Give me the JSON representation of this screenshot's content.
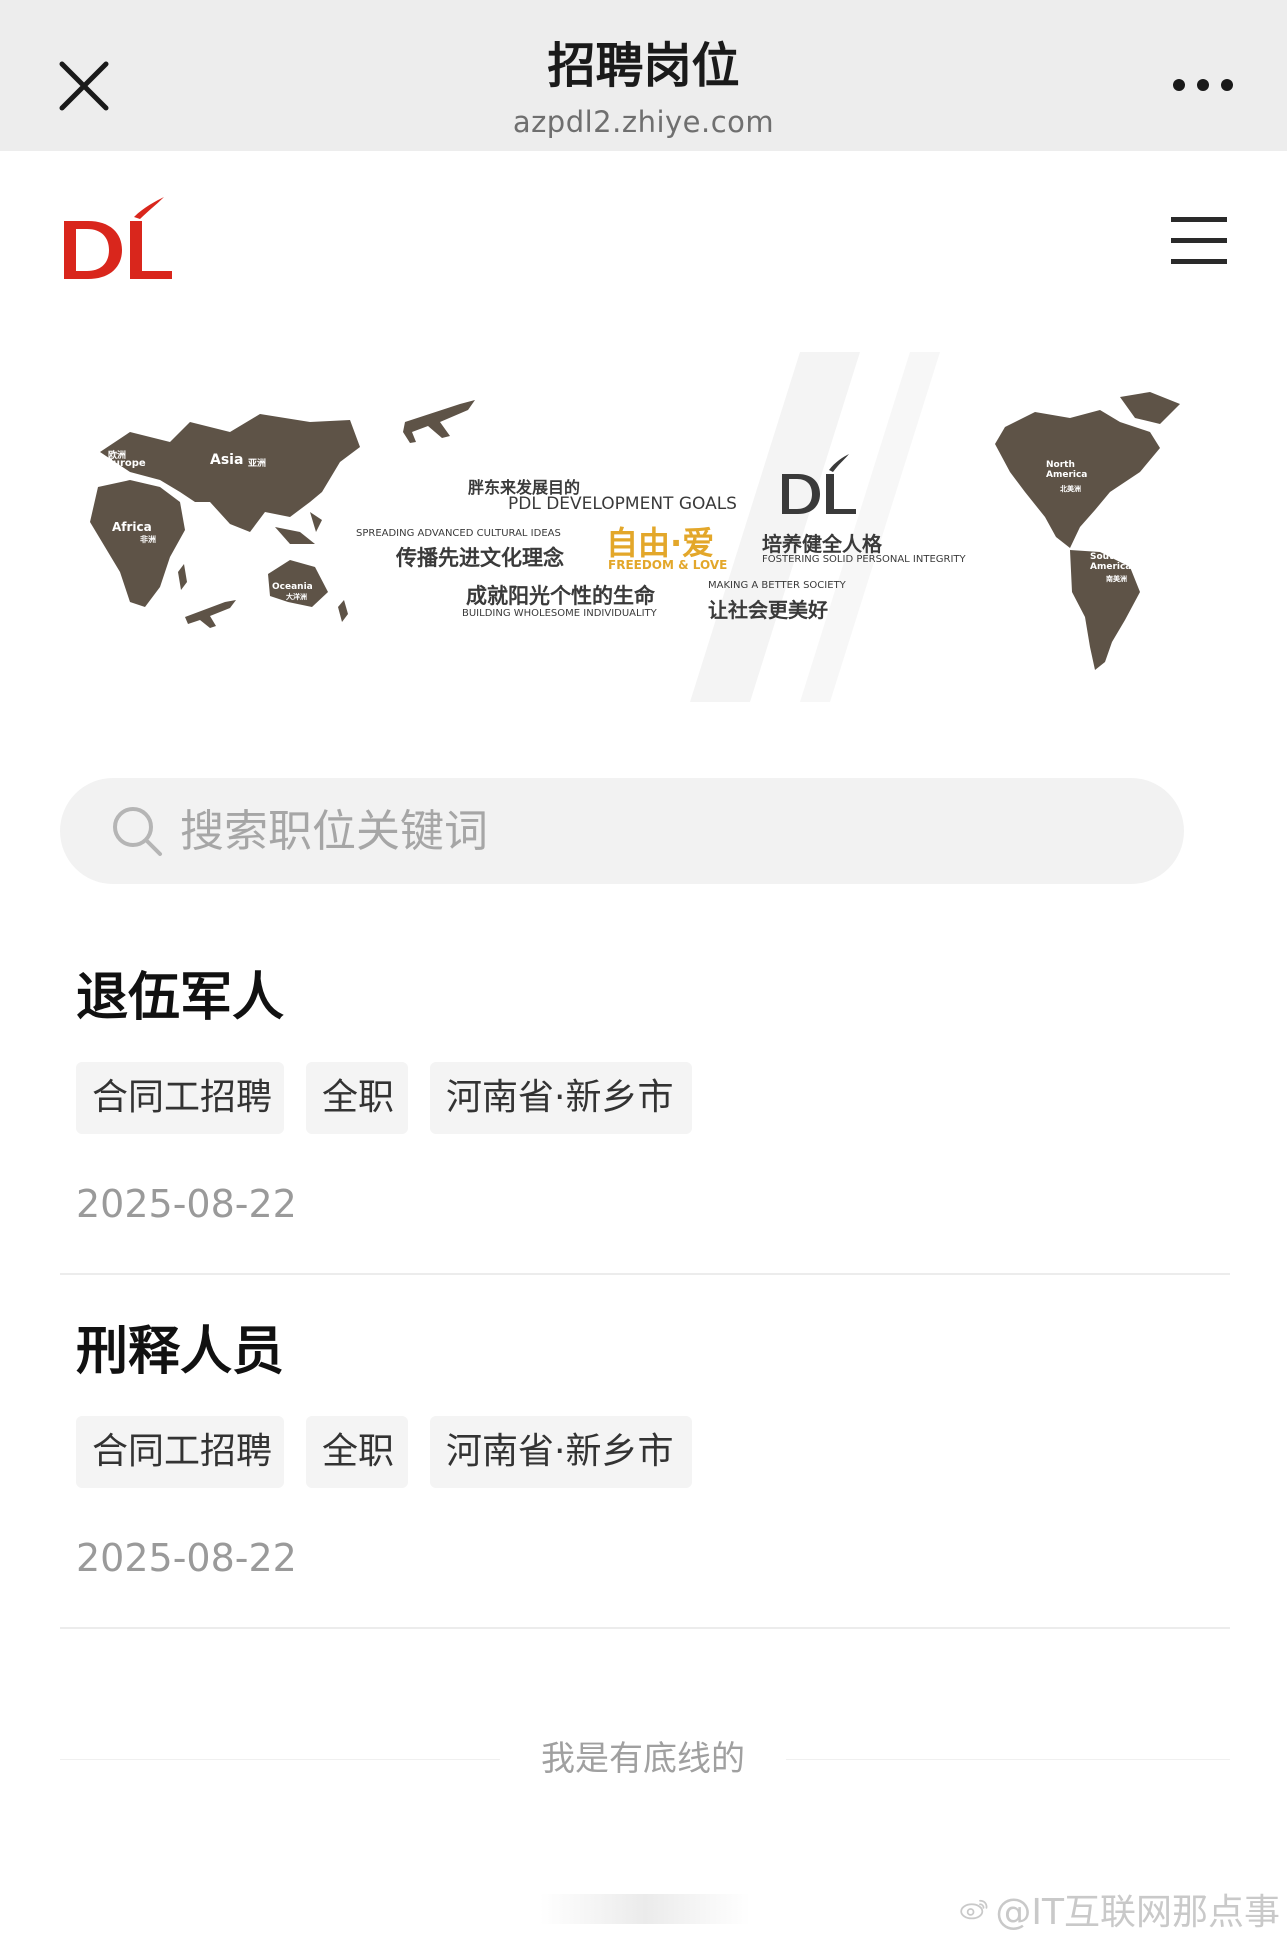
{
  "topbar": {
    "title": "招聘岗位",
    "url": "azpdl2.zhiye.com",
    "close_icon": "close-icon",
    "more_icon": "more-dots-icon"
  },
  "header": {
    "logo_text": "DL",
    "logo_color": "#d9261c",
    "menu_icon": "hamburger-menu-icon"
  },
  "banner": {
    "map_color": "#5e5347",
    "accent_gold": "#e3a72a",
    "continents": {
      "europe_cn": "欧洲",
      "europe": "Europe",
      "asia": "Asia",
      "asia_cn": "亚洲",
      "africa": "Africa",
      "africa_cn": "非洲",
      "oceania": "Oceania",
      "oceania_cn": "大洋洲",
      "north_america": "North America",
      "north_america_cn": "北美洲",
      "south_america": "South America",
      "south_america_cn": "南美洲"
    },
    "goal_cn": "胖东来发展目的",
    "goal_en": "PDL DEVELOPMENT GOALS",
    "logo_text": "DL",
    "left_en": "SPREADING ADVANCED CULTURAL IDEAS",
    "left_cn": "传播先进文化理念",
    "center_cn": "自由·爱",
    "center_en": "FREEDOM & LOVE",
    "right_cn": "培养健全人格",
    "right_en": "FOSTERING SOLID PERSONAL INTEGRITY",
    "bottom_left_cn": "成就阳光个性的生命",
    "bottom_left_en": "BUILDING WHOLESOME INDIVIDUALITY",
    "bottom_right_en": "MAKING A BETTER SOCIETY",
    "bottom_right_cn": "让社会更美好"
  },
  "search": {
    "placeholder": "搜索职位关键词",
    "icon": "search-icon"
  },
  "jobs": [
    {
      "title": "退伍军人",
      "tags": [
        "合同工招聘",
        "全职",
        "河南省·新乡市"
      ],
      "date": "2025-08-22"
    },
    {
      "title": "刑释人员",
      "tags": [
        "合同工招聘",
        "全职",
        "河南省·新乡市"
      ],
      "date": "2025-08-22"
    }
  ],
  "footer": {
    "text": "我是有底线的"
  },
  "watermark": {
    "text": "@IT互联网那点事",
    "icon": "weibo-icon"
  }
}
